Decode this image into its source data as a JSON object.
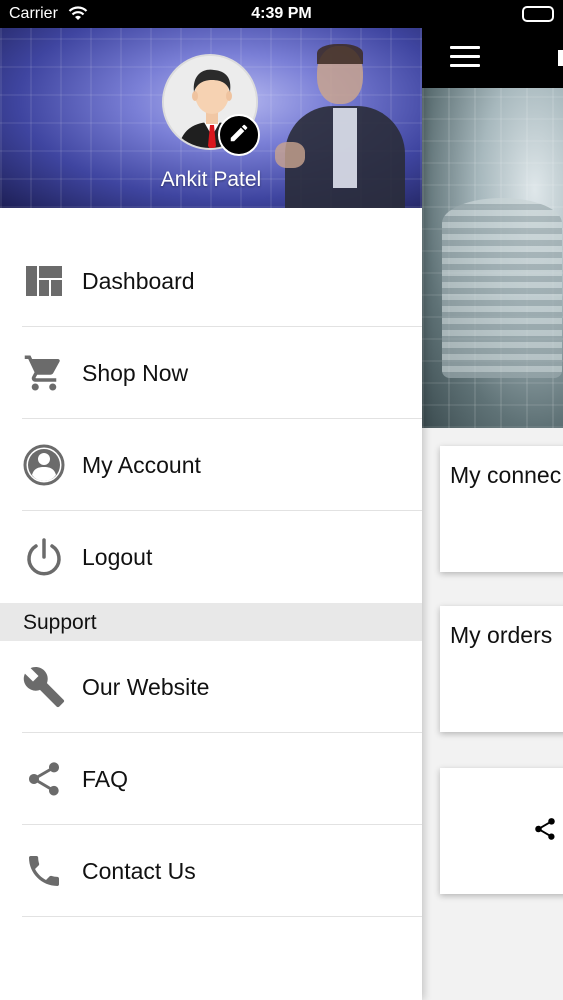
{
  "status_bar": {
    "carrier": "Carrier",
    "time": "4:39 PM"
  },
  "user": {
    "name": "Ankit Patel"
  },
  "menu": {
    "items": [
      {
        "label": "Dashboard",
        "icon": "dashboard-icon"
      },
      {
        "label": "Shop Now",
        "icon": "cart-icon"
      },
      {
        "label": "My Account",
        "icon": "account-icon"
      },
      {
        "label": "Logout",
        "icon": "power-icon"
      }
    ]
  },
  "support": {
    "title": "Support",
    "items": [
      {
        "label": "Our Website",
        "icon": "wrench-icon"
      },
      {
        "label": "FAQ",
        "icon": "share-icon"
      },
      {
        "label": "Contact Us",
        "icon": "phone-icon"
      }
    ]
  },
  "main": {
    "cards": [
      {
        "title": "My connec"
      },
      {
        "title": "My orders"
      },
      {
        "title": ""
      }
    ]
  },
  "colors": {
    "icon": "#6b6b6b",
    "drawer_bg": "#ffffff",
    "section_bg": "#e8e8e8",
    "header_bar": "#000000"
  }
}
